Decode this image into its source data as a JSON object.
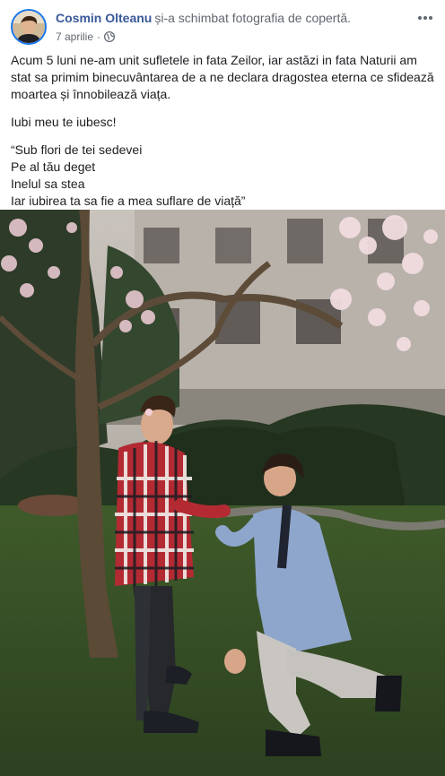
{
  "post": {
    "author": "Cosmin Olteanu",
    "action": "și-a schimbat fotografia de copertă.",
    "date": "7 aprilie",
    "separator": "·",
    "privacy_icon": "globe-icon",
    "more_icon": "more-options-icon"
  },
  "content": {
    "paragraph1": "Acum 5 luni ne-am unit sufletele in fata Zeilor, iar astăzi in fata Naturii am stat sa primim binecuvântarea de a ne declara dragostea eterna ce sfidează moartea și înnobilează viața.",
    "paragraph2": "Iubi meu te iubesc!",
    "verse": [
      "“Sub flori de tei sedevei",
      "Pe al tău deget",
      "Inelul sa stea",
      "Iar iubirea ta sa fie a mea suflare de viață”"
    ]
  },
  "colors": {
    "author_link": "#385898",
    "secondary_text": "#616770",
    "avatar_ring": "#1877f2"
  }
}
